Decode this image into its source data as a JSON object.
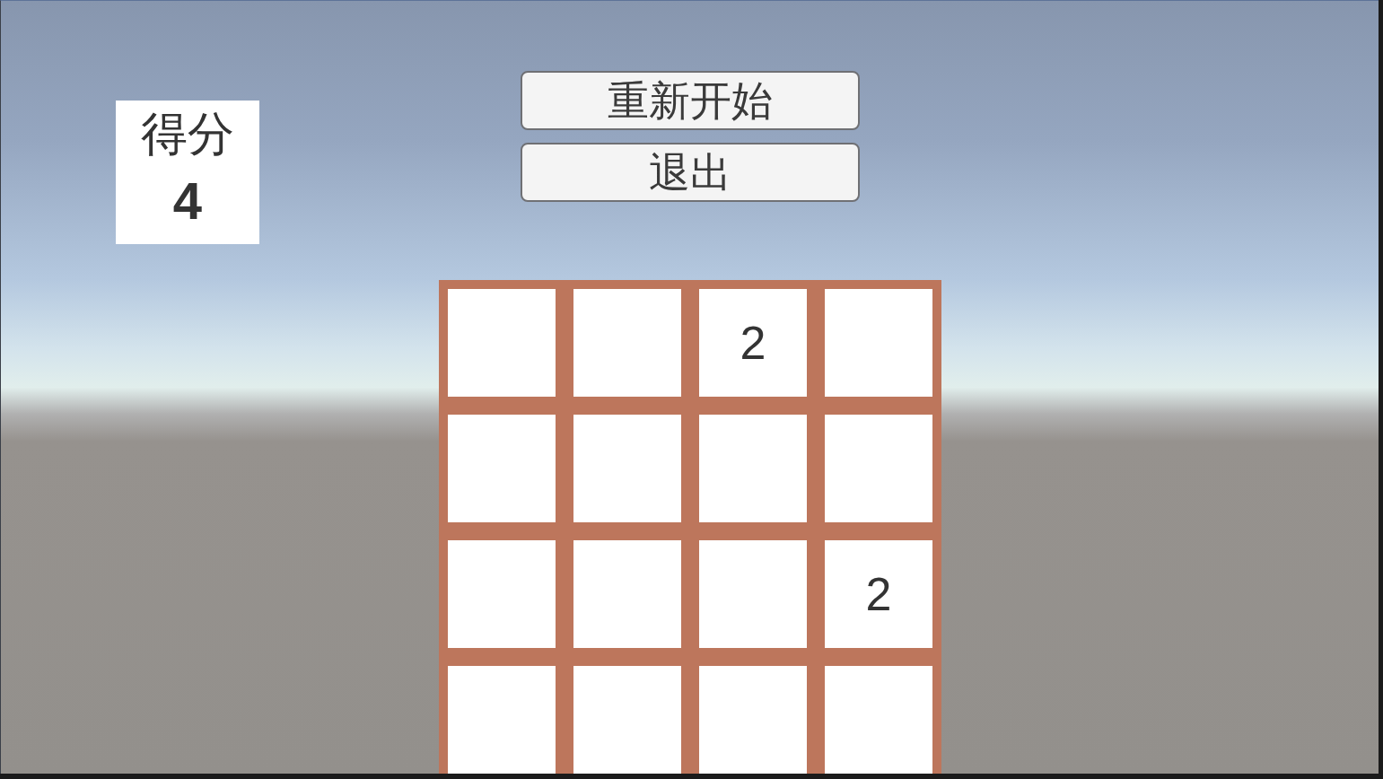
{
  "score_panel": {
    "label": "得分",
    "value": "4"
  },
  "buttons": [
    {
      "label": "重新开始"
    },
    {
      "label": "退出"
    }
  ],
  "board": {
    "rows": [
      [
        null,
        null,
        "2",
        null
      ],
      [
        null,
        null,
        null,
        null
      ],
      [
        null,
        null,
        null,
        "2"
      ],
      [
        null,
        null,
        null,
        null
      ]
    ]
  }
}
